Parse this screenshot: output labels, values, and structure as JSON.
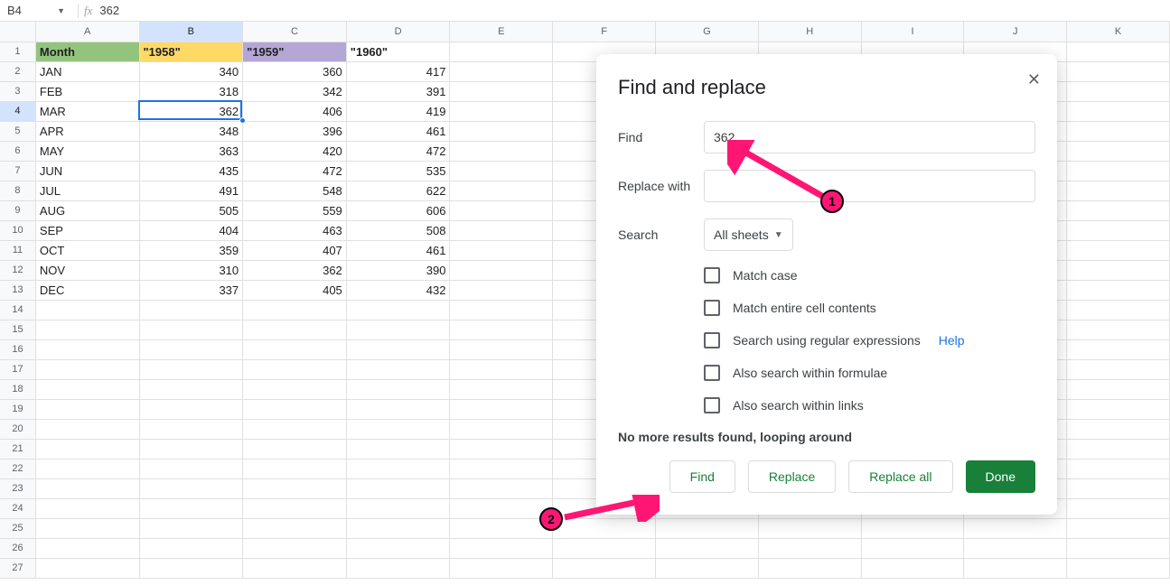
{
  "name_box": "B4",
  "formula_bar": "362",
  "columns": [
    "A",
    "B",
    "C",
    "D",
    "E",
    "F",
    "G",
    "H",
    "I",
    "J",
    "K"
  ],
  "selected_col": "B",
  "selected_row": 4,
  "header_row": {
    "month_label": "Month",
    "y1958": "\"1958\"",
    "y1959": "\"1959\"",
    "y1960": "\"1960\""
  },
  "data_rows": [
    {
      "month": "JAN",
      "a": 340,
      "b": 360,
      "c": 417
    },
    {
      "month": "FEB",
      "a": 318,
      "b": 342,
      "c": 391
    },
    {
      "month": "MAR",
      "a": 362,
      "b": 406,
      "c": 419
    },
    {
      "month": "APR",
      "a": 348,
      "b": 396,
      "c": 461
    },
    {
      "month": "MAY",
      "a": 363,
      "b": 420,
      "c": 472
    },
    {
      "month": "JUN",
      "a": 435,
      "b": 472,
      "c": 535
    },
    {
      "month": "JUL",
      "a": 491,
      "b": 548,
      "c": 622
    },
    {
      "month": "AUG",
      "a": 505,
      "b": 559,
      "c": 606
    },
    {
      "month": "SEP",
      "a": 404,
      "b": 463,
      "c": 508
    },
    {
      "month": "OCT",
      "a": 359,
      "b": 407,
      "c": 461
    },
    {
      "month": "NOV",
      "a": 310,
      "b": 362,
      "c": 390
    },
    {
      "month": "DEC",
      "a": 337,
      "b": 405,
      "c": 432
    }
  ],
  "empty_row_count": 14,
  "dialog": {
    "title": "Find and replace",
    "find_label": "Find",
    "find_value": "362",
    "replace_label": "Replace with",
    "replace_value": "",
    "search_label": "Search",
    "search_scope": "All sheets",
    "opts": {
      "match_case": "Match case",
      "match_entire": "Match entire cell contents",
      "regex": "Search using regular expressions",
      "regex_help": "Help",
      "formulae": "Also search within formulae",
      "links": "Also search within links"
    },
    "status": "No more results found, looping around",
    "buttons": {
      "find": "Find",
      "replace": "Replace",
      "replace_all": "Replace all",
      "done": "Done"
    }
  },
  "annotations": {
    "one": "1",
    "two": "2"
  }
}
